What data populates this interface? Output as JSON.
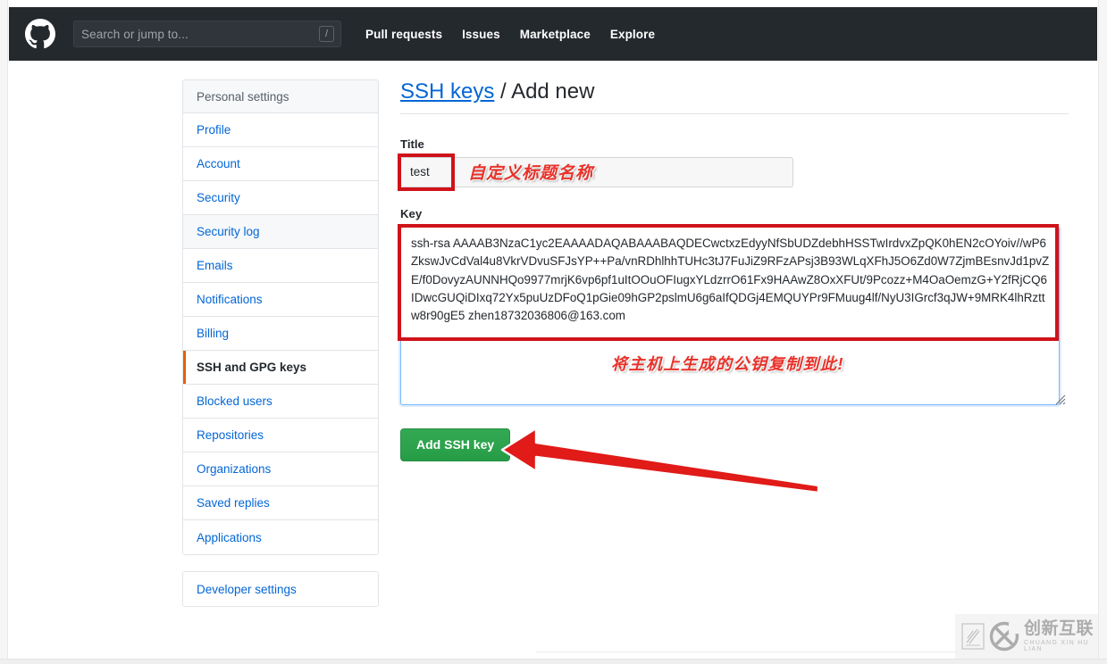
{
  "header": {
    "logo_icon": "github-mark-icon",
    "search": {
      "placeholder": "Search or jump to...",
      "shortcut_badge": "/"
    },
    "nav": [
      {
        "label": "Pull requests"
      },
      {
        "label": "Issues"
      },
      {
        "label": "Marketplace"
      },
      {
        "label": "Explore"
      }
    ],
    "background_color": "#24292e"
  },
  "sidebar": {
    "heading": "Personal settings",
    "items": [
      {
        "label": "Profile",
        "state": "normal"
      },
      {
        "label": "Account",
        "state": "normal"
      },
      {
        "label": "Security",
        "state": "normal"
      },
      {
        "label": "Security log",
        "state": "hovered"
      },
      {
        "label": "Emails",
        "state": "normal"
      },
      {
        "label": "Notifications",
        "state": "normal"
      },
      {
        "label": "Billing",
        "state": "normal"
      },
      {
        "label": "SSH and GPG keys",
        "state": "selected"
      },
      {
        "label": "Blocked users",
        "state": "normal"
      },
      {
        "label": "Repositories",
        "state": "normal"
      },
      {
        "label": "Organizations",
        "state": "normal"
      },
      {
        "label": "Saved replies",
        "state": "normal"
      },
      {
        "label": "Applications",
        "state": "normal"
      }
    ],
    "developer_settings": {
      "label": "Developer settings"
    },
    "active_marker_color": "#e36209"
  },
  "main": {
    "title_link": "SSH keys",
    "title_separator": " / ",
    "title_current": "Add new",
    "title_label": "Title",
    "title_value": "test",
    "title_annotation": "自定义标题名称",
    "key_label": "Key",
    "key_value": "ssh-rsa AAAAB3NzaC1yc2EAAAADAQABAAABAQDECwctxzEdyyNfSbUDZdebhHSSTwIrdvxZpQK0hEN2cOYoiv//wP6ZkswJvCdVal4u8VkrVDvuSFJsYP++Pa/vnRDhlhhTUHc3tJ7FuJiZ9RFzAPsj3B93WLqXFhJ5O6Zd0W7ZjmBEsnvJd1pvZE/f0DovyzAUNNHQo9977mrjK6vp6pf1uItOOuOFIugxYLdzrrO61Fx9HAAwZ8OxXFUt/9Pcozz+M4OaOemzG+Y2fRjCQ6IDwcGUQiDIxq72Yx5puUzDFoQ1pGie09hGP2pslmU6g6aIfQDGj4EMQUYPr9FMuug4lf/NyU3IGrcf3qJW+9MRK4lhRzttw8r90gE5 zhen18732036806@163.com",
    "key_annotation": "将主机上生成的公钥复制到此!",
    "submit_label": "Add SSH key",
    "submit_color": "#2ea44f",
    "annotation_color": "#e8322a",
    "highlight_box_color": "#d0121a",
    "focus_border_color": "#79b8ff"
  },
  "watermark": {
    "cn": "创新互联",
    "en": "CHUANG XIN HU LIAN",
    "logo_icon": "circled-x-logo-icon",
    "seal_icon": "seal-stamp-icon"
  }
}
